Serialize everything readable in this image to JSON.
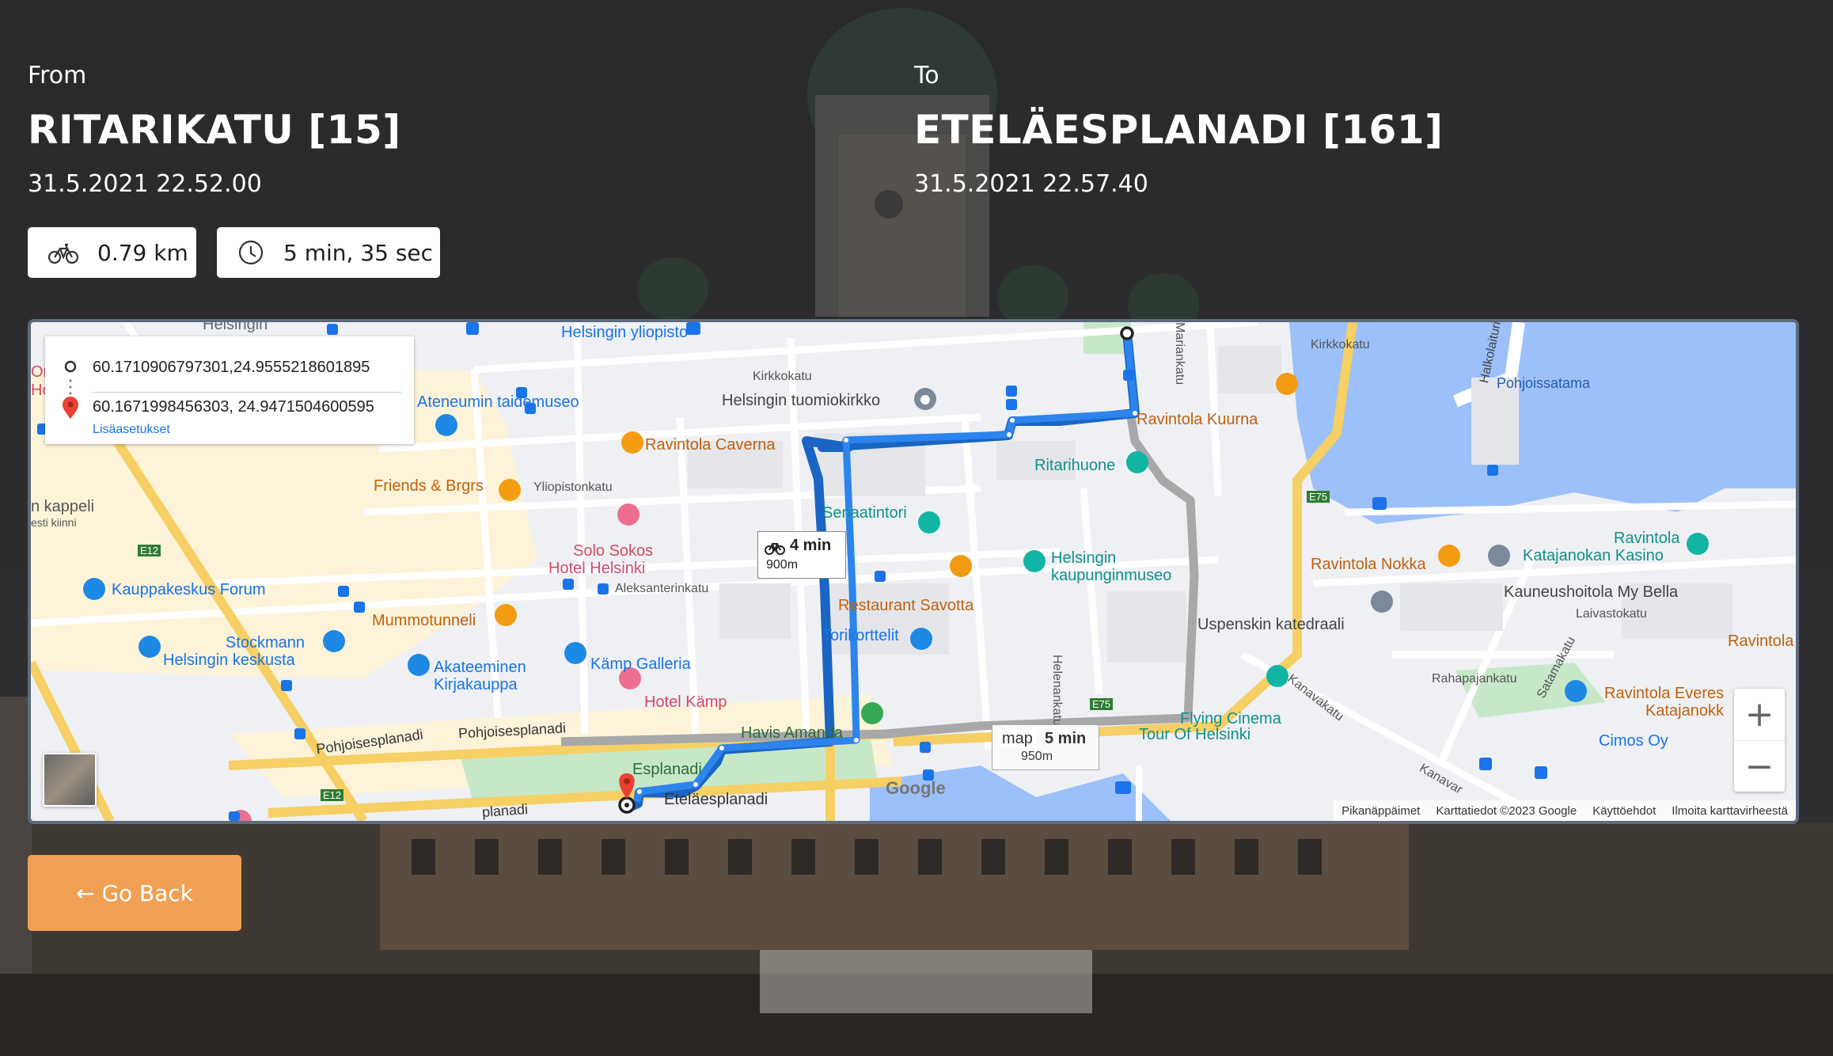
{
  "from": {
    "label": "From",
    "station": "RITARIKATU [15]",
    "time": "31.5.2021 22.52.00"
  },
  "to": {
    "label": "To",
    "station": "ETELÄESPLANADI [161]",
    "time": "31.5.2021 22.57.40"
  },
  "stats": {
    "distance": "0.79 km",
    "duration": "5 min, 35 sec",
    "distance_icon": "bicycle-icon",
    "duration_icon": "clock-icon"
  },
  "map": {
    "origin_coords": "60.1710906797301,24.9555218601895",
    "destination_coords": "60.1671998456303, 24.9471504600595",
    "more_options": "Lisäasetukset",
    "route1_time": "4 min",
    "route1_dist": "900m",
    "route2_time": "5 min",
    "route2_dist": "950m",
    "map_tooltip": "map",
    "zoom_in": "+",
    "zoom_out": "−",
    "attribution": [
      "Pikanäppäimet",
      "Karttatiedot ©2023 Google",
      "Käyttöehdot",
      "Ilmoita karttavirheestä"
    ],
    "google_logo": "Google",
    "labels": {
      "helsingin_yliopisto": "Helsingin yliopisto",
      "kirkkokatu1": "Kirkkokatu",
      "kirkkokatu2": "Kirkkokatu",
      "tuomiokirkko": "Helsingin tuomiokirkko",
      "ateneum": "Ateneumin taidemuseo",
      "caverna": "Ravintola Caverna",
      "friends": "Friends & Brgrs",
      "yliopistonkatu": "Yliopistonkatu",
      "kappeli1": "n kappeli",
      "kappeli2": "esti kiinni",
      "solo1": "Solo Sokos",
      "solo2": "Hotel Helsinki",
      "forum": "Kauppakeskus Forum",
      "aleksanterinkatu": "Aleksanterinkatu",
      "mummotunneli": "Mummotunneli",
      "stockmann1": "Stockmann",
      "stockmann2": "Helsingin keskusta",
      "akateeminen1": "Akateeminen",
      "akateeminen2": "Kirjakauppa",
      "kamp_galleria": "Kämp Galleria",
      "hotel_kamp": "Hotel Kämp",
      "pohjoisesplanadi1": "Pohjoisesplanadi",
      "pohjoisesplanadi2": "Pohjoisesplanadi",
      "esplanadi": "Esplanadi",
      "etelaesplanadi1": "Eteläesplanadi",
      "etelaesplanadi2": "planadi",
      "senaatintori": "Senaatintori",
      "ritarihuone": "Ritarihuone",
      "kuurna": "Ravintola Kuurna",
      "kaupunginmuseo1": "Helsingin",
      "kaupunginmuseo2": "kaupunginmuseo",
      "savotta": "Restaurant Savotta",
      "torikorttelit": "Torikorttelit",
      "havis": "Havis Amanda",
      "helenankatu": "Helenankatu",
      "mariankatu": "Mariankatu",
      "pohjoissatama": "Pohjoissatama",
      "halkolaituri": "Halkolaituri",
      "nokka": "Ravintola Nokka",
      "katajanokan1": "Ravintola",
      "katajanokan2": "Katajanokan Kasino",
      "bella": "Kauneushoitola My Bella",
      "laivastokatu": "Laivastokatu",
      "uspenski": "Uspenskin katedraali",
      "ravintola_edge": "Ravintola",
      "rahapajankatu": "Rahapajankatu",
      "satamakatu": "Satamakatu",
      "kanavakatu": "Kanavakatu",
      "kanavaranta": "Kanavar",
      "everest1": "Ravintola Everes",
      "everest2": "Katajanokk",
      "cimos": "Cimos Oy",
      "flying1": "Flying Cinema",
      "flying2": "Tour Of Helsinki",
      "e12a": "E12",
      "e12b": "E12",
      "e75a": "E75",
      "e75b": "E75",
      "helsingin_top": "Helsingin",
      "partial_or": "Or",
      "partial_ho": "Ho"
    }
  },
  "go_back": "← Go Back",
  "colors": {
    "accent": "#f0a054",
    "route_blue": "#2c84ec",
    "route_gray": "#a8a8a8",
    "water": "#9cc0f9"
  }
}
